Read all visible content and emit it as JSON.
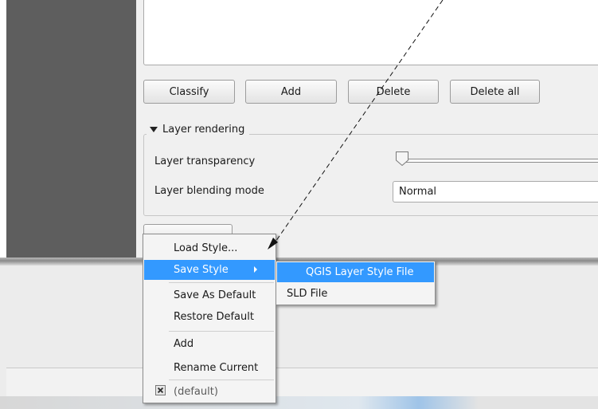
{
  "classification": {
    "buttons": {
      "classify": "Classify",
      "add": "Add",
      "delete": "Delete",
      "delete_all": "Delete all"
    }
  },
  "layer_rendering": {
    "group_title": "Layer rendering",
    "transparency_label": "Layer transparency",
    "transparency_value_percent": 0,
    "blending_label": "Layer blending mode",
    "blending_value": "Normal"
  },
  "style_menu": {
    "items": [
      {
        "label": "Load Style..."
      },
      {
        "label": "Save Style"
      },
      {
        "label": "Save As Default"
      },
      {
        "label": "Restore Default"
      },
      {
        "label": "Add"
      },
      {
        "label": "Rename Current"
      },
      {
        "label": "(default)"
      }
    ],
    "highlight_color": "#3399ff"
  },
  "save_style_submenu": {
    "items": [
      {
        "label": "QGIS Layer Style File"
      },
      {
        "label": "SLD File"
      }
    ]
  }
}
